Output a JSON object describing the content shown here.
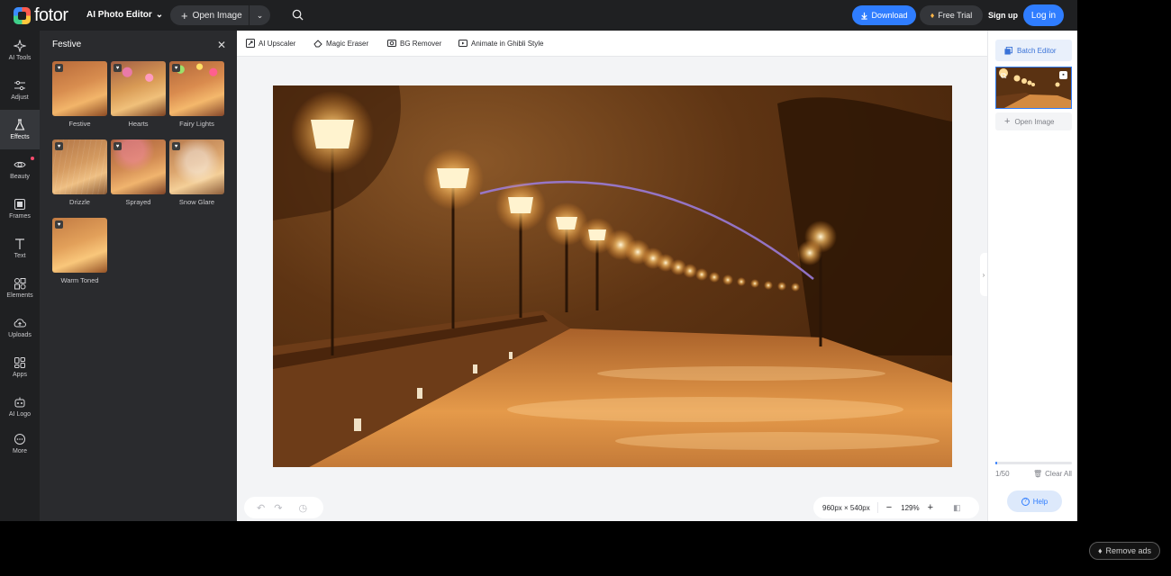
{
  "topbar": {
    "logo_text": "fotor",
    "product_label": "AI Photo Editor",
    "open_image_label": "Open Image",
    "download_label": "Download",
    "free_trial_label": "Free Trial",
    "signup_label": "Sign up",
    "login_label": "Log in"
  },
  "rail": {
    "items": [
      {
        "label": "AI Tools",
        "icon": "sparkle-icon"
      },
      {
        "label": "Adjust",
        "icon": "sliders-icon"
      },
      {
        "label": "Effects",
        "icon": "flask-icon"
      },
      {
        "label": "Beauty",
        "icon": "eye-icon"
      },
      {
        "label": "Frames",
        "icon": "frame-icon"
      },
      {
        "label": "Text",
        "icon": "text-icon"
      },
      {
        "label": "Elements",
        "icon": "shapes-icon"
      },
      {
        "label": "Uploads",
        "icon": "cloud-upload-icon"
      },
      {
        "label": "Apps",
        "icon": "apps-icon"
      },
      {
        "label": "AI Logo",
        "icon": "robot-icon"
      },
      {
        "label": "More",
        "icon": "more-icon"
      }
    ],
    "active": "Effects"
  },
  "panel": {
    "title": "Festive",
    "effects": [
      {
        "label": "Festive"
      },
      {
        "label": "Hearts"
      },
      {
        "label": "Fairy Lights"
      },
      {
        "label": "Drizzle"
      },
      {
        "label": "Sprayed"
      },
      {
        "label": "Snow Glare"
      },
      {
        "label": "Warm Toned"
      }
    ]
  },
  "toolstrip": {
    "items": [
      {
        "label": "AI Upscaler"
      },
      {
        "label": "Magic Eraser"
      },
      {
        "label": "BG Remover"
      },
      {
        "label": "Animate in Ghibli Style"
      }
    ]
  },
  "canvas": {
    "dimensions": "960px × 540px",
    "zoom": "129%"
  },
  "right": {
    "batch_label": "Batch Editor",
    "open_image_label": "Open Image",
    "quota_text": "1/50",
    "quota_fraction": 0.02,
    "clear_all_label": "Clear All",
    "help_label": "Help"
  },
  "remove_ads_label": "Remove ads",
  "colors": {
    "accent": "#2f7dff",
    "dark": "#1f2022",
    "panel": "#2a2b2e"
  }
}
